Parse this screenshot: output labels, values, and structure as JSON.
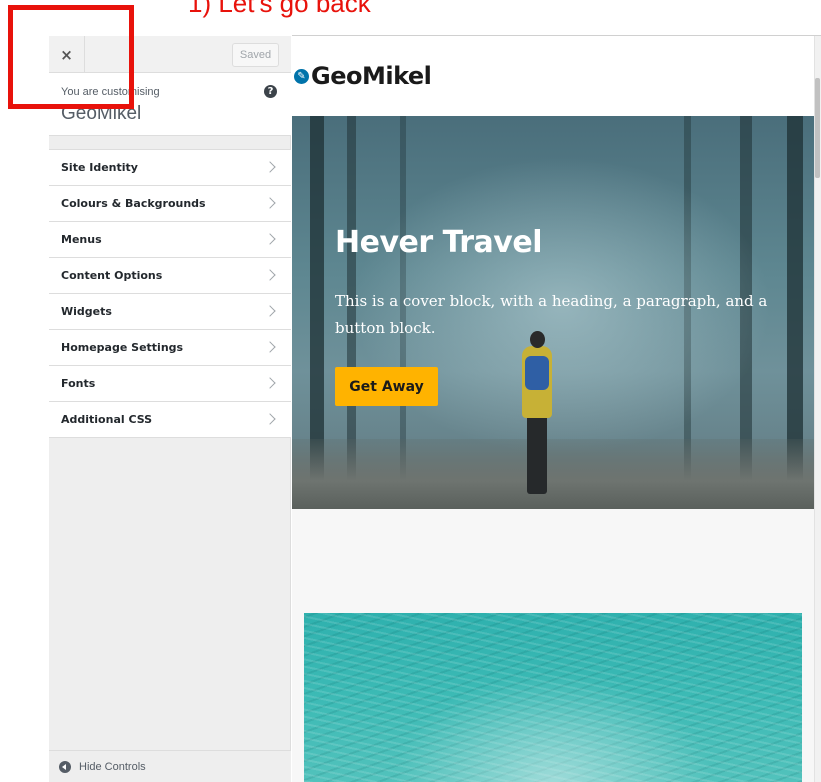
{
  "annotation": {
    "text": "1) Let's go back"
  },
  "sidebar": {
    "close_label": "×",
    "saved_label": "Saved",
    "customising_label": "You are customising",
    "site_name": "GeoMikel",
    "help_icon": "?",
    "items": [
      {
        "label": "Site Identity"
      },
      {
        "label": "Colours & Backgrounds"
      },
      {
        "label": "Menus"
      },
      {
        "label": "Content Options"
      },
      {
        "label": "Widgets"
      },
      {
        "label": "Homepage Settings"
      },
      {
        "label": "Fonts"
      },
      {
        "label": "Additional CSS"
      }
    ],
    "hide_controls_label": "Hide Controls"
  },
  "preview": {
    "site_title": "GeoMikel",
    "cover": {
      "heading": "Hever Travel",
      "text": "This is a cover block, with a heading, a paragraph, and a button block.",
      "button_label": "Get Away",
      "button_color": "#ffb300"
    }
  },
  "colors": {
    "annotation": "#e8120b",
    "edit_shortcut": "#0073aa"
  }
}
